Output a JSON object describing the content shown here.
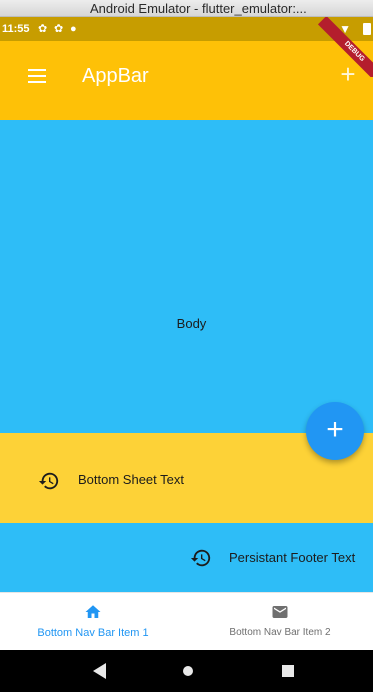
{
  "window": {
    "title": "Android Emulator - flutter_emulator:..."
  },
  "status_bar": {
    "time": "11:55",
    "debug_banner": "DEBUG"
  },
  "app_bar": {
    "title": "AppBar",
    "menu_icon": "menu-icon",
    "action_icon": "add-icon"
  },
  "body": {
    "text": "Body"
  },
  "fab": {
    "icon": "add-icon",
    "symbol": "+"
  },
  "bottom_sheet": {
    "text": "Bottom Sheet Text",
    "icon": "history-icon"
  },
  "persistent_footer": {
    "text": "Persistant Footer Text",
    "icon": "history-icon"
  },
  "bottom_nav": {
    "items": [
      {
        "label": "Bottom Nav Bar Item 1",
        "icon": "home-icon",
        "selected": true
      },
      {
        "label": "Bottom Nav Bar Item 2",
        "icon": "mail-icon",
        "selected": false
      }
    ]
  },
  "colors": {
    "status_bar": "#c79d00",
    "app_bar": "#fec107",
    "body": "#2ebdf7",
    "bottom_sheet": "#fdd237",
    "fab": "#2196f3",
    "nav_selected": "#2196f3",
    "nav_unselected": "#6f6f6f"
  }
}
